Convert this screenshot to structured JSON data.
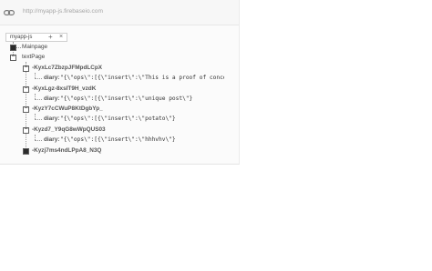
{
  "urlbar": {
    "url": "http://myapp-js.firebaseio.com"
  },
  "tab": {
    "label": "myapp-js",
    "add_symbol": "+",
    "close_symbol": "×"
  },
  "tree": {
    "mainpage": {
      "key": "Mainpage"
    },
    "textpage": {
      "key": "textPage"
    },
    "entries": [
      {
        "key": "-KyxLc7ZbzpJFMpdLCpX",
        "field": "diary:",
        "value": "\"{\\\"ops\\\":[{\\\"insert\\\":\\\"This is a proof of concept."
      },
      {
        "key": "-KyxLgz-8xslT9H_vzdK",
        "field": "diary:",
        "value": "\"{\\\"ops\\\":[{\\\"insert\\\":\\\"unique post\\\"}"
      },
      {
        "key": "-KyzY7cCWuP8KtDgbYp_",
        "field": "diary:",
        "value": "\"{\\\"ops\\\":[{\\\"insert\\\":\\\"potato\\\"}"
      },
      {
        "key": "-Kyzd7_Y9qG8wWpQUS03",
        "field": "diary:",
        "value": "\"{\\\"ops\\\":[{\\\"insert\\\":\\\"hhhvhv\\\"}"
      },
      {
        "key": "-Kyzj7ms4ndLPpA8_N3Q"
      }
    ]
  },
  "icons": {
    "url": "link-icon",
    "expand": "plus-toggle-icon",
    "collapse": "minus-toggle-icon"
  }
}
